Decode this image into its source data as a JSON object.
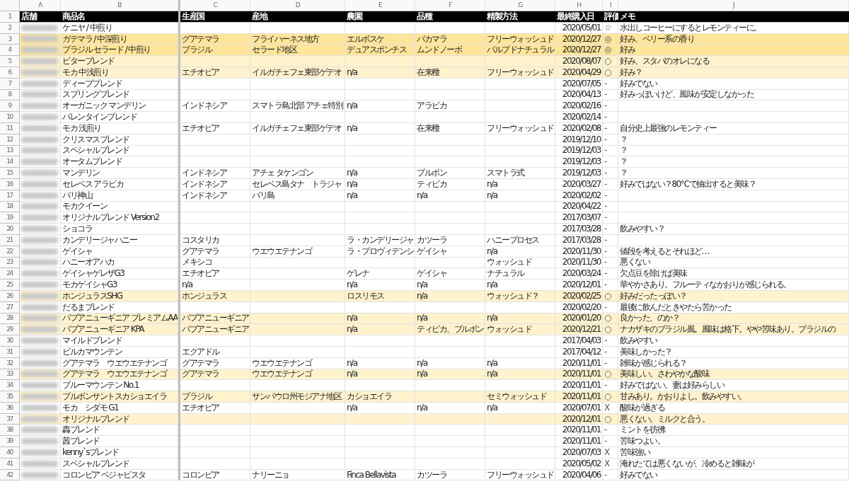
{
  "column_letters": [
    "A",
    "B",
    "C",
    "D",
    "E",
    "F",
    "G",
    "H",
    "I",
    "J"
  ],
  "header": {
    "num": "1",
    "cells": [
      "店舗",
      "商品名",
      "生産国",
      "産地",
      "農園",
      "品種",
      "精製方法",
      "最終購入日",
      "評価",
      "メモ"
    ]
  },
  "rows": [
    {
      "num": "2",
      "name": "ケニヤ / 中煎り",
      "date": "2020/05/01",
      "rating": "☆",
      "memo": "水出しコーヒーにするとレモンティーに。"
    },
    {
      "num": "3",
      "color": "#ffe599",
      "name": "ガテマラ / 中深煎り",
      "country": "グアテマラ",
      "region": "フライハーネス地方",
      "farm": "エルボスケ",
      "variety": "パカマラ",
      "process": "フリーウォッシュド",
      "date": "2020/12/27",
      "rating": "◎",
      "memo": "好み、ベリー系の香り"
    },
    {
      "num": "4",
      "color": "#ffe599",
      "name": "ブラジル セラード / 中煎り",
      "country": "ブラジル",
      "region": "セラード地区",
      "farm": "デュアスポンチス",
      "variety": "ムンドノーボ",
      "process": "パルプドナチュラル",
      "date": "2020/12/27",
      "rating": "◎",
      "memo": "好み"
    },
    {
      "num": "5",
      "color": "#fff2cc",
      "name": "ビターブレンド",
      "date": "2020/08/07",
      "rating": "○",
      "memo": "好み、スタバのオレになる"
    },
    {
      "num": "6",
      "color": "#fff2cc",
      "name": "モカ 中浅煎り",
      "country": "エチオピア",
      "region": "イルガチェフェ東部ゲデオ",
      "farm": "n/a",
      "variety": "在来種",
      "process": "フリーウォッシュド",
      "date": "2020/04/29",
      "rating": "○",
      "memo": "好み？"
    },
    {
      "num": "7",
      "name": "ディープブレンド",
      "date": "2020/07/05",
      "rating": "-",
      "memo": "好みでない"
    },
    {
      "num": "8",
      "name": "スプリングブレンド",
      "date": "2020/04/13",
      "rating": "-",
      "memo": "好みっぽいけど、風味が安定しなかった"
    },
    {
      "num": "9",
      "name": "オーガニック マンデリン",
      "country": "インドネシア",
      "region": "スマトラ島北部 アチェ特別",
      "farm": "n/a",
      "variety": "アラビカ",
      "date": "2020/02/16",
      "rating": "-"
    },
    {
      "num": "10",
      "name": "バレンタインブレンド",
      "date": "2020/02/14",
      "rating": "-"
    },
    {
      "num": "11",
      "name": "モカ 浅煎り",
      "country": "エチオピア",
      "region": "イルガチェフェ東部ゲデオ",
      "farm": "n/a",
      "variety": "在来種",
      "process": "フリーウォッシュド",
      "date": "2020/02/08",
      "rating": "-",
      "memo": "自分史上最強のレモンティー"
    },
    {
      "num": "12",
      "name": "クリスマスブレンド",
      "date": "2019/12/10",
      "rating": "-",
      "memo": "？"
    },
    {
      "num": "13",
      "name": "スペシャルブレンド",
      "date": "2019/12/03",
      "rating": "-",
      "memo": "？"
    },
    {
      "num": "14",
      "name": "オータムブレンド",
      "date": "2019/12/03",
      "rating": "-",
      "memo": "？"
    },
    {
      "num": "15",
      "name": "マンデリン",
      "country": "インドネシア",
      "region": "アチェ タケンゴン",
      "farm": "n/a",
      "variety": "ブルボン",
      "process": "スマトラ式",
      "date": "2019/12/03",
      "rating": "-",
      "memo": "？"
    },
    {
      "num": "16",
      "name": "セレベス アラビカ",
      "country": "インドネシア",
      "region": "セレベス島タナ　トラジャ",
      "farm": "n/a",
      "variety": "ティピカ",
      "process": "n/a",
      "date": "2020/03/27",
      "rating": "-",
      "memo": "好みではない？80℃で抽出すると美味？"
    },
    {
      "num": "17",
      "name": "バリ神山",
      "country": "インドネシア",
      "region": "バリ島",
      "farm": "n/a",
      "variety": "n/a",
      "process": "n/a",
      "date": "2020/02/02",
      "rating": "-"
    },
    {
      "num": "18",
      "name": "モカクイーン",
      "date": "2020/04/22",
      "rating": "-"
    },
    {
      "num": "19",
      "name": "オリジナルブレンド Version2",
      "date": "2017/03/07",
      "rating": "-"
    },
    {
      "num": "20",
      "name": "ショコラ",
      "date": "2017/03/28",
      "rating": "-",
      "memo": "飲みやすい？"
    },
    {
      "num": "21",
      "name": "カンデリージャハニー",
      "country": "コスタリカ",
      "farm": "ラ・カンデリージャ",
      "variety": "カツーラ",
      "process": "ハニープロセス",
      "date": "2017/03/28",
      "rating": "-"
    },
    {
      "num": "22",
      "name": "ゲイシャ",
      "country": "グアテマラ",
      "region": "ウエウエテナンゴ",
      "farm": "ラ・プロヴィデンシ",
      "variety": "ゲイシャ",
      "process": "n/a",
      "date": "2020/11/30",
      "rating": "-",
      "memo": "値段を考えるとそれほど…"
    },
    {
      "num": "23",
      "name": "ハニーオアハカ",
      "country": "メキシコ",
      "process": "ウォッシュド",
      "date": "2020/11/30",
      "rating": "-",
      "memo": "悪くない"
    },
    {
      "num": "24",
      "name": "ゲイシャゲレザG3",
      "country": "エチオピア",
      "farm": "ゲレナ",
      "variety": "ゲイシャ",
      "process": "ナチュラル",
      "date": "2020/03/24",
      "rating": "-",
      "memo": "欠点豆を除けば美味"
    },
    {
      "num": "25",
      "name": "モカゲイシャG3",
      "country": "n/a",
      "farm": "n/a",
      "variety": "n/a",
      "process": "n/a",
      "date": "2020/12/01",
      "rating": "-",
      "memo": "華やかさあり。フルーティなかおりが感じられる。"
    },
    {
      "num": "26",
      "color": "#fff2cc",
      "name": "ホンジュラスSHG",
      "country": "ホンジュラス",
      "farm": "ロスリモス",
      "variety": "n/a",
      "process": "ウォッシュド？",
      "date": "2020/02/25",
      "rating": "○",
      "memo": "好みだったっぽい？"
    },
    {
      "num": "27",
      "name": "だるまブレンド",
      "date": "2020/02/20",
      "rating": "-",
      "memo": "最後に飲んだときやたら苦かった"
    },
    {
      "num": "28",
      "color": "#fff2cc",
      "name": "パプアニューギニア プレミアムAA",
      "country": "パプアニューギニア",
      "farm": "n/a",
      "variety": "n/a",
      "process": "n/a",
      "date": "2020/01/20",
      "rating": "○",
      "memo": "良かった、のか？"
    },
    {
      "num": "29",
      "color": "#fff2cc",
      "name": "パプアニューギニア KPA",
      "country": "パプアニューギニア",
      "farm": "n/a",
      "variety": "ティピカ、ブルボン",
      "process": "ウォッシュド",
      "date": "2020/12/21",
      "rating": "○",
      "memo": "ナカザキのブラジル風。風味は格下。やや苦味あり。ブラジルの"
    },
    {
      "num": "30",
      "name": "マイルドブレンド",
      "date": "2017/04/03",
      "rating": "-",
      "memo": "飲みやすい"
    },
    {
      "num": "31",
      "name": "ビルカマウンテン",
      "country": "エクアドル",
      "date": "2017/04/12",
      "rating": "-",
      "memo": "美味しかった？"
    },
    {
      "num": "32",
      "name": "グアテマラ　ウエウエテナンゴ",
      "country": "グアテマラ",
      "region": "ウエウエテナンゴ",
      "farm": "n/a",
      "variety": "n/a",
      "process": "n/a",
      "date": "2020/11/01",
      "rating": "-",
      "memo": "雑味が感じられる？"
    },
    {
      "num": "33",
      "color": "#fff2cc",
      "name": "グアテマラ　ウエウエテナンゴ",
      "country": "グアテマラ",
      "region": "ウエウエテナンゴ",
      "farm": "n/a",
      "variety": "n/a",
      "process": "n/a",
      "date": "2020/11/01",
      "rating": "○",
      "memo": "美味しい。さわやかな酸味"
    },
    {
      "num": "34",
      "name": "ブルーマウンテン No.1",
      "date": "2020/11/01",
      "rating": "-",
      "memo": "好みではない。妻は好みらしい"
    },
    {
      "num": "35",
      "color": "#fff2cc",
      "name": "ブルボンサントスカショエイラ",
      "country": "ブラジル",
      "region": "サンパウロ州モジアナ地区",
      "farm": "カショエイラ",
      "process": "セミウォッシュド",
      "date": "2020/11/01",
      "rating": "○",
      "memo": "甘みあり。かおりよし。飲みやすい。"
    },
    {
      "num": "36",
      "name": "モカ　シダモ G1",
      "country": "エチオピア",
      "farm": "n/a",
      "variety": "n/a",
      "process": "n/a",
      "date": "2020/07/01",
      "rating": "X",
      "memo": "酸味が過ぎる"
    },
    {
      "num": "37",
      "color": "#fff2cc",
      "name": "オリジナルブレンド",
      "date": "2020/12/01",
      "rating": "○",
      "memo": "悪くない。ミルクと合う。"
    },
    {
      "num": "38",
      "name": "轟ブレンド",
      "date": "2020/11/01",
      "rating": "-",
      "memo": "ミントを彷彿"
    },
    {
      "num": "39",
      "name": "茜ブレンド",
      "date": "2020/11/01",
      "rating": "-",
      "memo": "苦味つよい。"
    },
    {
      "num": "40",
      "name": "kenny`sブレンド",
      "date": "2020/07/03",
      "rating": "X",
      "memo": "苦味強い"
    },
    {
      "num": "41",
      "name": "スペシャルブレンド",
      "date": "2020/05/02",
      "rating": "X",
      "memo": "淹れたては悪くないが、冷めると雑味が"
    },
    {
      "num": "42",
      "name": "コロンビア ベジャビスタ",
      "country": "コロンビア",
      "region": "ナリーニョ",
      "farm": "Finca Bellavista",
      "variety": "カツーラ",
      "process": "フリーウォッシュド",
      "date": "2020/04/06",
      "rating": "-",
      "memo": "好みでない"
    }
  ]
}
